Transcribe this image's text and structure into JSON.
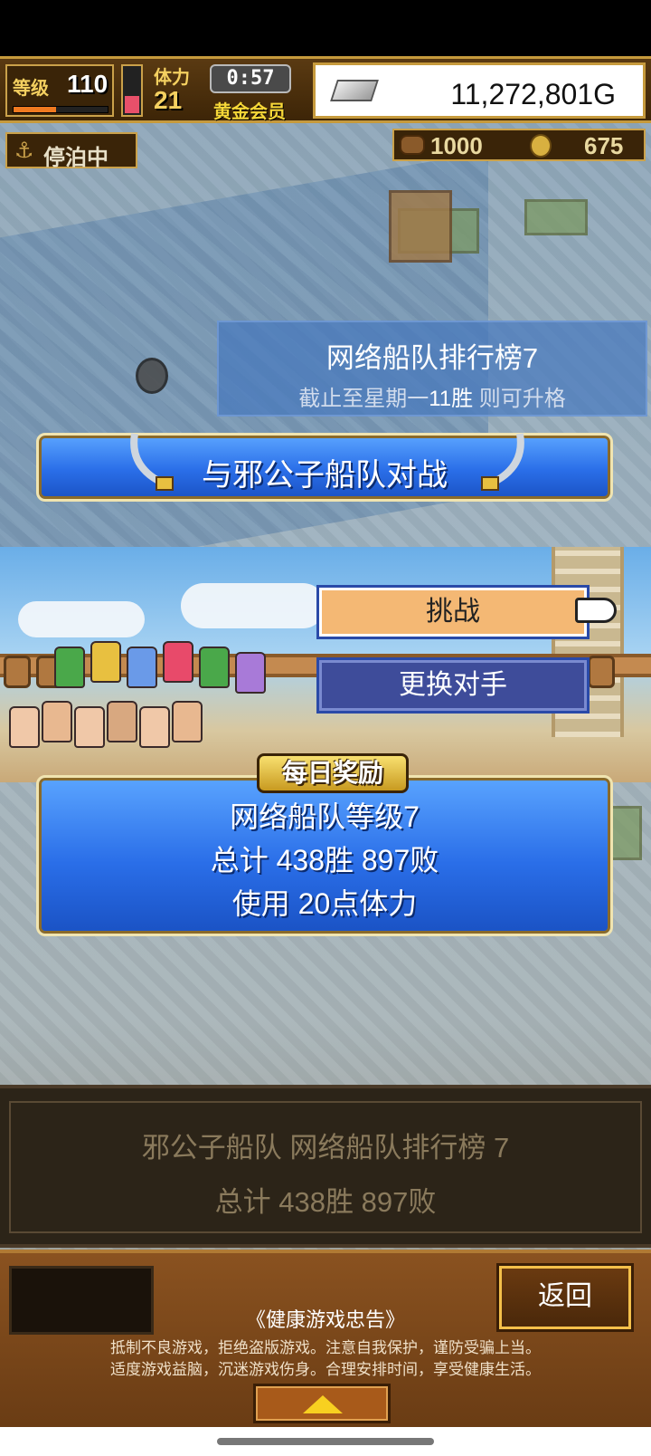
{
  "hud": {
    "level_label": "等级",
    "level": "110",
    "level_progress": 0.45,
    "stamina_level": 0.35,
    "stamina_label": "体力",
    "stamina": "21",
    "timer": "0:57",
    "membership": "黄金会员",
    "money": "11,272,801G"
  },
  "status": {
    "anchor_icon": "anchor-icon",
    "docked": "停泊中",
    "wood": "1000",
    "coins": "675"
  },
  "ranking": {
    "title": "网络船队排行榜7",
    "sub_prefix": "截止至星期一",
    "sub_highlight": "11胜",
    "sub_suffix": " 则可升格"
  },
  "battle_button": "与邪公子船队对战",
  "menu": {
    "challenge": "挑战",
    "change_opponent": "更换对手"
  },
  "fleet": {
    "reward_tag": "每日奖励",
    "level_line": "网络船队等级7",
    "record_line": "总计 438胜 897败",
    "cost_line": "使用 20点体力"
  },
  "info": {
    "line1": "邪公子船队  网络船队排行榜  7",
    "line2": "总计 438胜 897败"
  },
  "footer": {
    "back": "返回",
    "notice_title": "《健康游戏忠告》",
    "notice_line1": "抵制不良游戏，拒绝盗版游戏。注意自我保护，谨防受骗上当。",
    "notice_line2": "适度游戏益脑，沉迷游戏伤身。合理安排时间，享受健康生活。"
  },
  "colors": {
    "accent_blue": "#2a6ee8",
    "gold_frame": "#c69a3c",
    "challenge_bg": "#f4b874",
    "change_bg": "#3e4c9a"
  }
}
